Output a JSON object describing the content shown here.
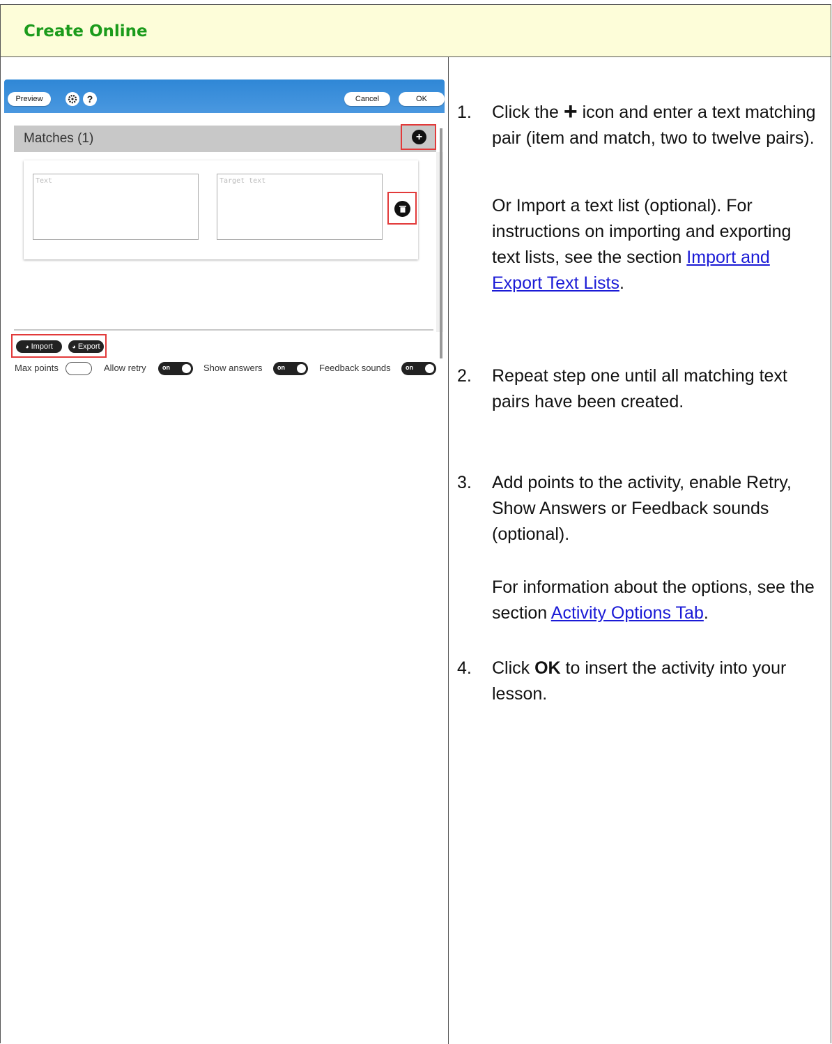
{
  "header": {
    "title": "Create Online"
  },
  "editor": {
    "toolbar": {
      "preview_label": "Preview",
      "settings_icon": "gear-icon",
      "help_label": "?",
      "cancel_label": "Cancel",
      "ok_label": "OK"
    },
    "matches": {
      "title": "Matches (1)",
      "add_icon": "+",
      "pair": {
        "text_placeholder": "Text",
        "target_placeholder": "Target text"
      }
    },
    "list_buttons": {
      "import_label": "Import",
      "export_label": "Export"
    },
    "options": {
      "max_points_label": "Max points",
      "allow_retry_label": "Allow retry",
      "show_answers_label": "Show answers",
      "feedback_sounds_label": "Feedback sounds",
      "toggle_on_label": "on"
    }
  },
  "steps": {
    "s1": {
      "num": "1.",
      "pre": "Click the ",
      "icon": "+",
      "post": " icon and enter a text matching pair (item and match, two to twelve pairs).",
      "p2_pre": "Or Import a text list (optional). For instructions on importing and exporting text lists, see the section ",
      "p2_link": "Import and Export Text Lists",
      "p2_post": "."
    },
    "s2": {
      "num": "2.",
      "text": "Repeat step one until all matching text pairs have been created."
    },
    "s3": {
      "num": "3.",
      "text": "Add points to the activity, enable Retry, Show Answers or Feedback sounds (optional).",
      "p2_pre": "For information about the options, see the section ",
      "p2_link": "Activity Options Tab",
      "p2_post": "."
    },
    "s4": {
      "num": "4.",
      "pre": "Click ",
      "bold": "OK",
      "post": " to insert the activity into your lesson."
    }
  }
}
